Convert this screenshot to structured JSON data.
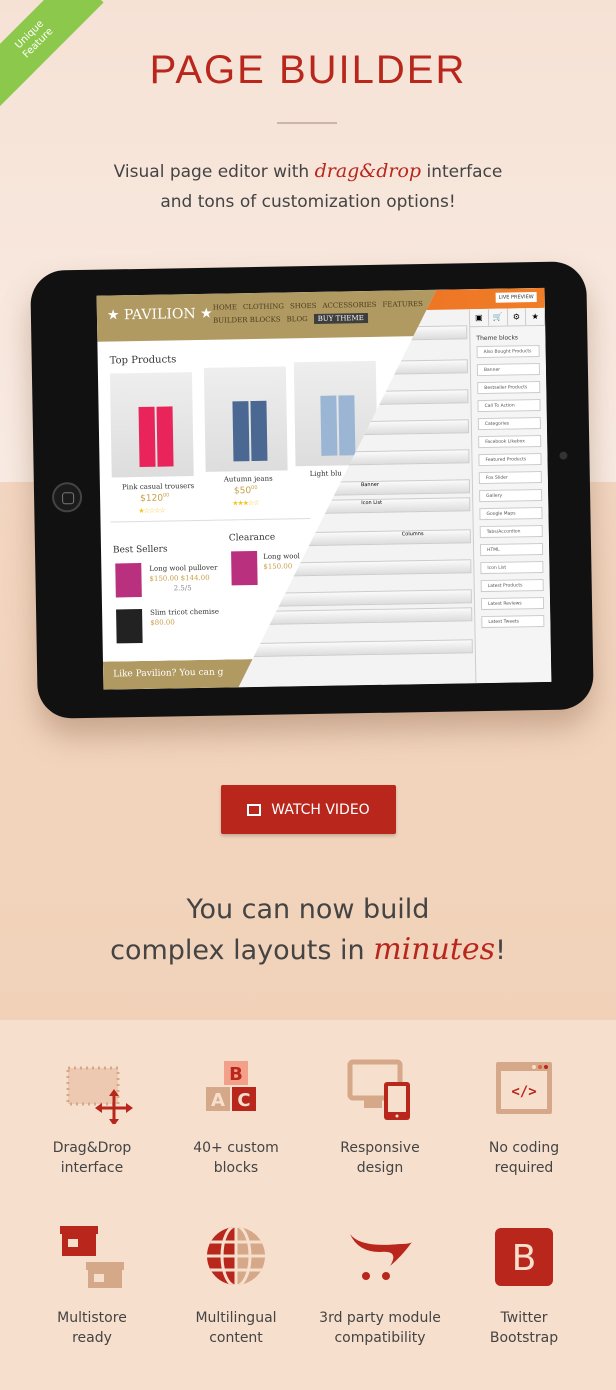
{
  "ribbon": {
    "line1": "Unique",
    "line2": "Feature"
  },
  "title": "PAGE  BUILDER",
  "subtitle": {
    "before": "Visual page editor with ",
    "highlight": "drag&drop",
    "after": " interface",
    "line2": "and tons of customization options!"
  },
  "tablet": {
    "logo": "★ PAVILION ★",
    "nav": [
      "HOME",
      "CLOTHING",
      "SHOES",
      "ACCESSORIES",
      "FEATURES",
      "BUILDER BLOCKS",
      "BLOG"
    ],
    "buy_theme": "BUY THEME",
    "top_products": "Top Products",
    "products": [
      {
        "name": "Pink casual trousers",
        "price": "$120",
        "cents": "00",
        "stars": "★☆☆☆☆"
      },
      {
        "name": "Autumn jeans",
        "price": "$50",
        "cents": "00",
        "stars": "★★★☆☆"
      },
      {
        "name": "Light blu",
        "price": "",
        "cents": "",
        "stars": ""
      }
    ],
    "best_sellers": "Best Sellers",
    "best": [
      {
        "name": "Long wool pullover",
        "price": "$150.00 $144.00",
        "rating": "2.5/5"
      },
      {
        "name": "Slim tricot chemise",
        "price": "$80.00",
        "rating": ""
      }
    ],
    "clearance": "Clearance",
    "clearance_item": "Long wool",
    "clearance_price": "$150.00",
    "footer": "Like Pavilion? You can g",
    "live_preview": "LIVE PREVIEW",
    "side_tabs": [
      "▣",
      "🛒",
      "⚙",
      "★"
    ],
    "theme_blocks": "Theme blocks",
    "blocks": [
      "Also Bought Products",
      "Banner",
      "Bestseller Products",
      "Call To Action",
      "Categories",
      "Facebook Likebox",
      "Featured Products",
      "Fox Slider",
      "Gallery",
      "Google Maps",
      "Tabs/Accordion",
      "HTML",
      "Icon List",
      "Latest Products",
      "Latest Reviews",
      "Latest Tweets"
    ],
    "columns_label": "Columns",
    "banner": "Banner",
    "icon_list": "Icon List"
  },
  "watch_video": "WATCH VIDEO",
  "headline": {
    "line1": "You can now build",
    "line2_before": "complex layouts in ",
    "highlight": "minutes",
    "end": "!"
  },
  "features": [
    {
      "icon": "drag-drop-icon",
      "line1": "Drag&Drop",
      "line2": "interface"
    },
    {
      "icon": "abc-blocks-icon",
      "line1": "40+ custom",
      "line2": "blocks"
    },
    {
      "icon": "responsive-devices-icon",
      "line1": "Responsive",
      "line2": "design"
    },
    {
      "icon": "code-window-icon",
      "line1": "No coding",
      "line2": "required"
    },
    {
      "icon": "multistore-icon",
      "line1": "Multistore",
      "line2": "ready"
    },
    {
      "icon": "globe-icon",
      "line1": "Multilingual",
      "line2": "content"
    },
    {
      "icon": "opencart-cart-icon",
      "line1": "3rd party module",
      "line2": "compatibility"
    },
    {
      "icon": "bootstrap-icon",
      "line1": "Twitter",
      "line2": "Bootstrap"
    }
  ],
  "colors": {
    "accent": "#b8261c",
    "ribbon": "#8cc84b",
    "tan": "#d4a888",
    "gold": "#b09a62"
  }
}
